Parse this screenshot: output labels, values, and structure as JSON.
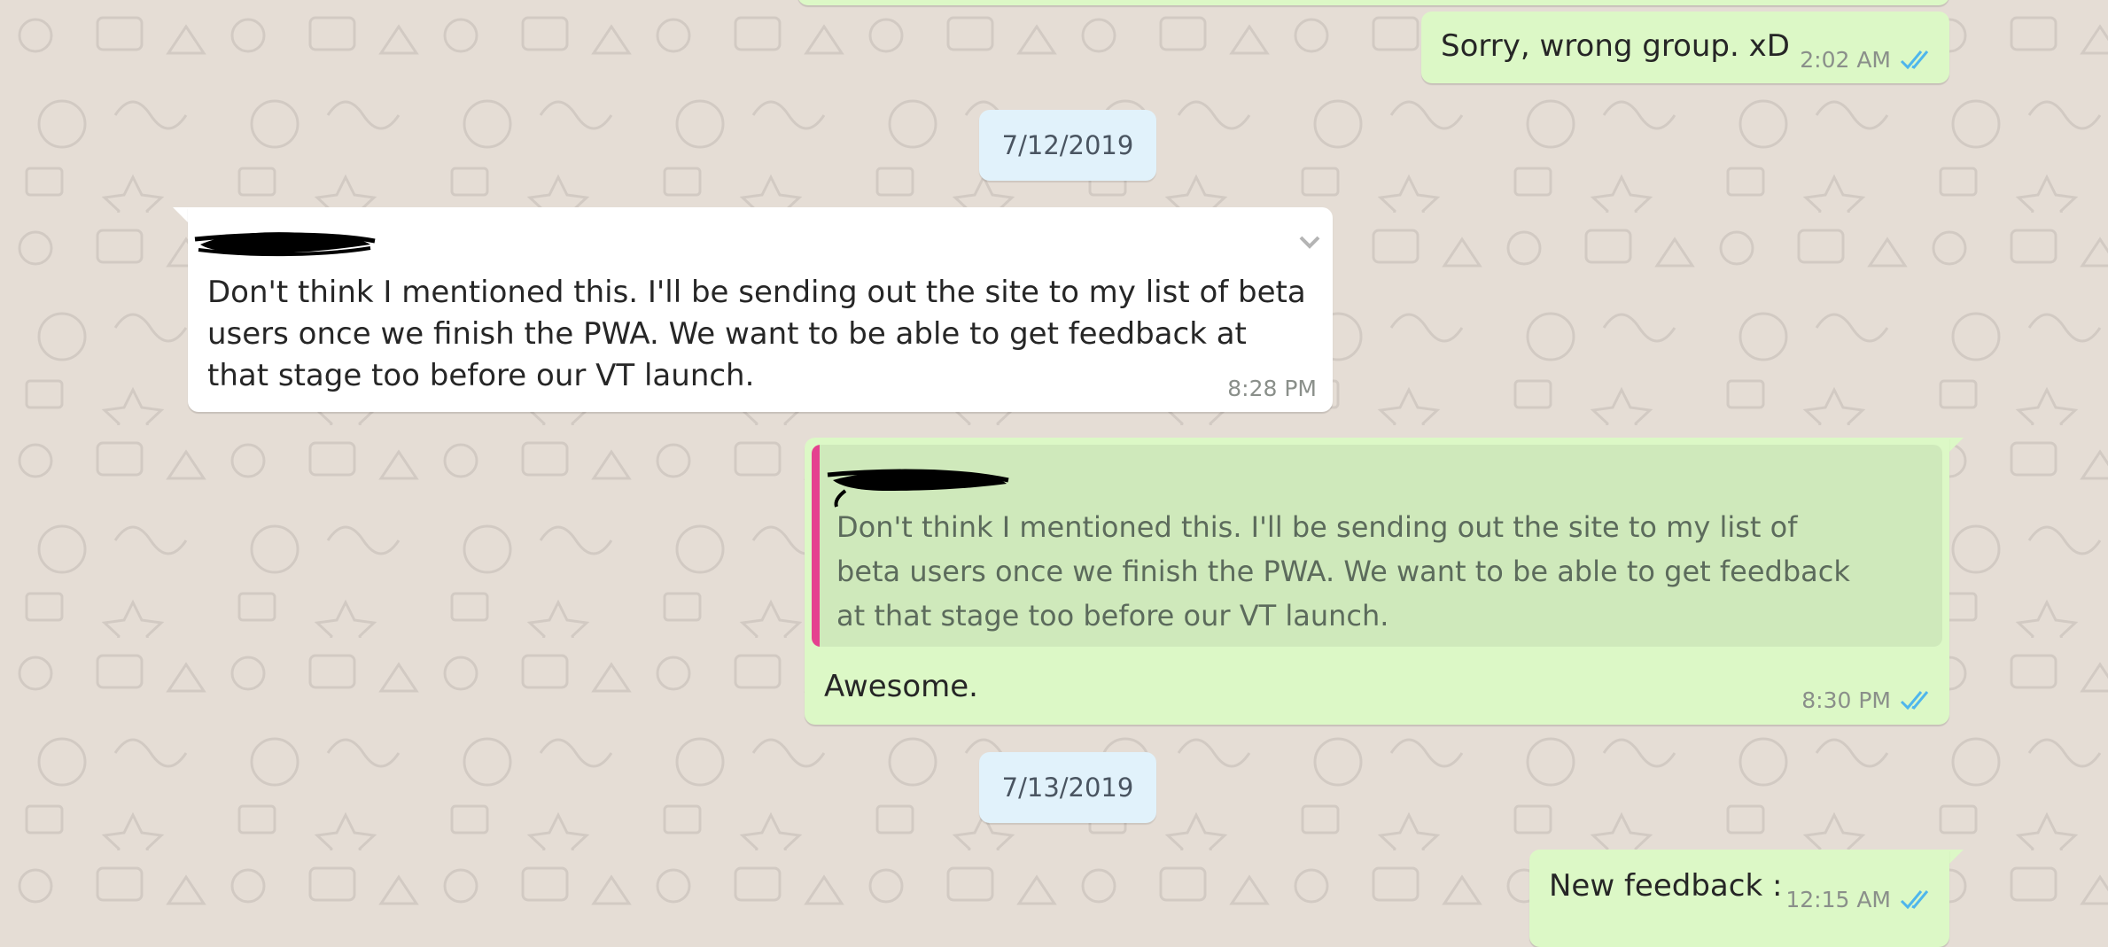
{
  "messages": [
    {
      "id": "m1",
      "direction": "outgoing",
      "text": "Sorry, wrong group. xD",
      "time": "2:02 AM",
      "status_icon": "double-check-read-icon"
    },
    {
      "id": "m2",
      "direction": "incoming",
      "sender": "",
      "text": "Don't think I mentioned this. I'll be sending out the site to my list of beta users once we finish the PWA. We want to be able to get feedback at that stage too before our VT launch.",
      "time": "8:28 PM"
    },
    {
      "id": "m3",
      "direction": "outgoing",
      "quoted_text": "Don't think I mentioned this. I'll be sending out the site to my list of beta users once we finish the PWA. We want to be able to get feedback at that stage too before our VT launch.",
      "text": "Awesome.",
      "time": "8:30 PM",
      "status_icon": "double-check-read-icon"
    },
    {
      "id": "m4",
      "direction": "outgoing",
      "text": "New feedback :",
      "time": "12:15 AM",
      "status_icon": "double-check-read-icon"
    }
  ],
  "date_separators": [
    "7/12/2019",
    "7/13/2019"
  ],
  "colors": {
    "chat_background": "#e5ddd5",
    "outgoing_bubble": "#dcf8c6",
    "incoming_bubble": "#ffffff",
    "date_chip": "#e1f2fb",
    "quote_background": "#cfe9bb",
    "quote_bar": "#e5418f",
    "read_ticks": "#4fb6ec"
  },
  "icons": {
    "message_menu": "chevron-down-icon",
    "read_receipt": "double-check-read-icon"
  }
}
